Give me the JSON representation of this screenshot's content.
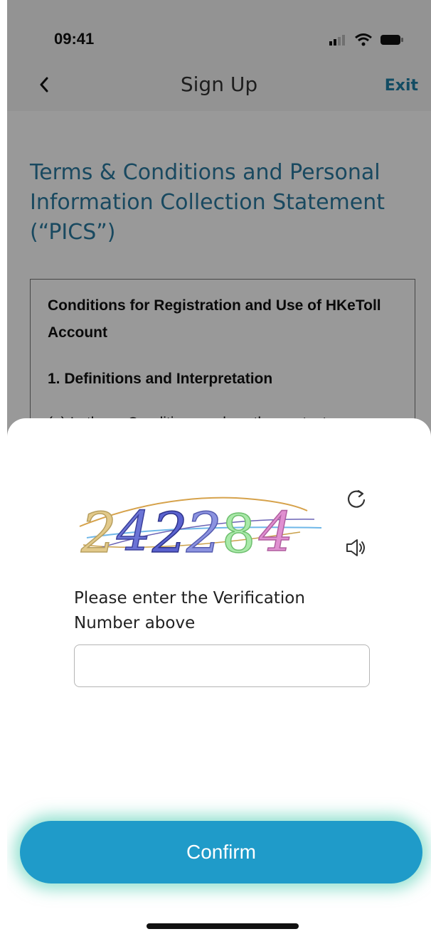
{
  "status_bar": {
    "time": "09:41"
  },
  "nav": {
    "title": "Sign Up",
    "exit_label": "Exit"
  },
  "page": {
    "heading": "Terms & Conditions and Personal Information Collection Statement (“PICS”)",
    "terms_title": "Conditions for Registration and Use of HKeToll Account",
    "terms_section": "1. Definitions and Interpretation",
    "terms_cut_text": "(a) In these Conditions, unless the context"
  },
  "modal": {
    "captcha_text": "242284",
    "prompt": "Please enter the Verification Number above",
    "input_value": "",
    "input_placeholder": "",
    "confirm_label": "Confirm"
  },
  "colors": {
    "accent": "#1f9bc9",
    "heading": "#2a7aa0",
    "exit": "#1f7fa6",
    "glow": "#3cc8aa"
  },
  "icons": {
    "back": "chevron-left-icon",
    "refresh": "refresh-icon",
    "audio": "speaker-icon",
    "signal": "signal-icon",
    "wifi": "wifi-icon",
    "battery": "battery-icon"
  }
}
